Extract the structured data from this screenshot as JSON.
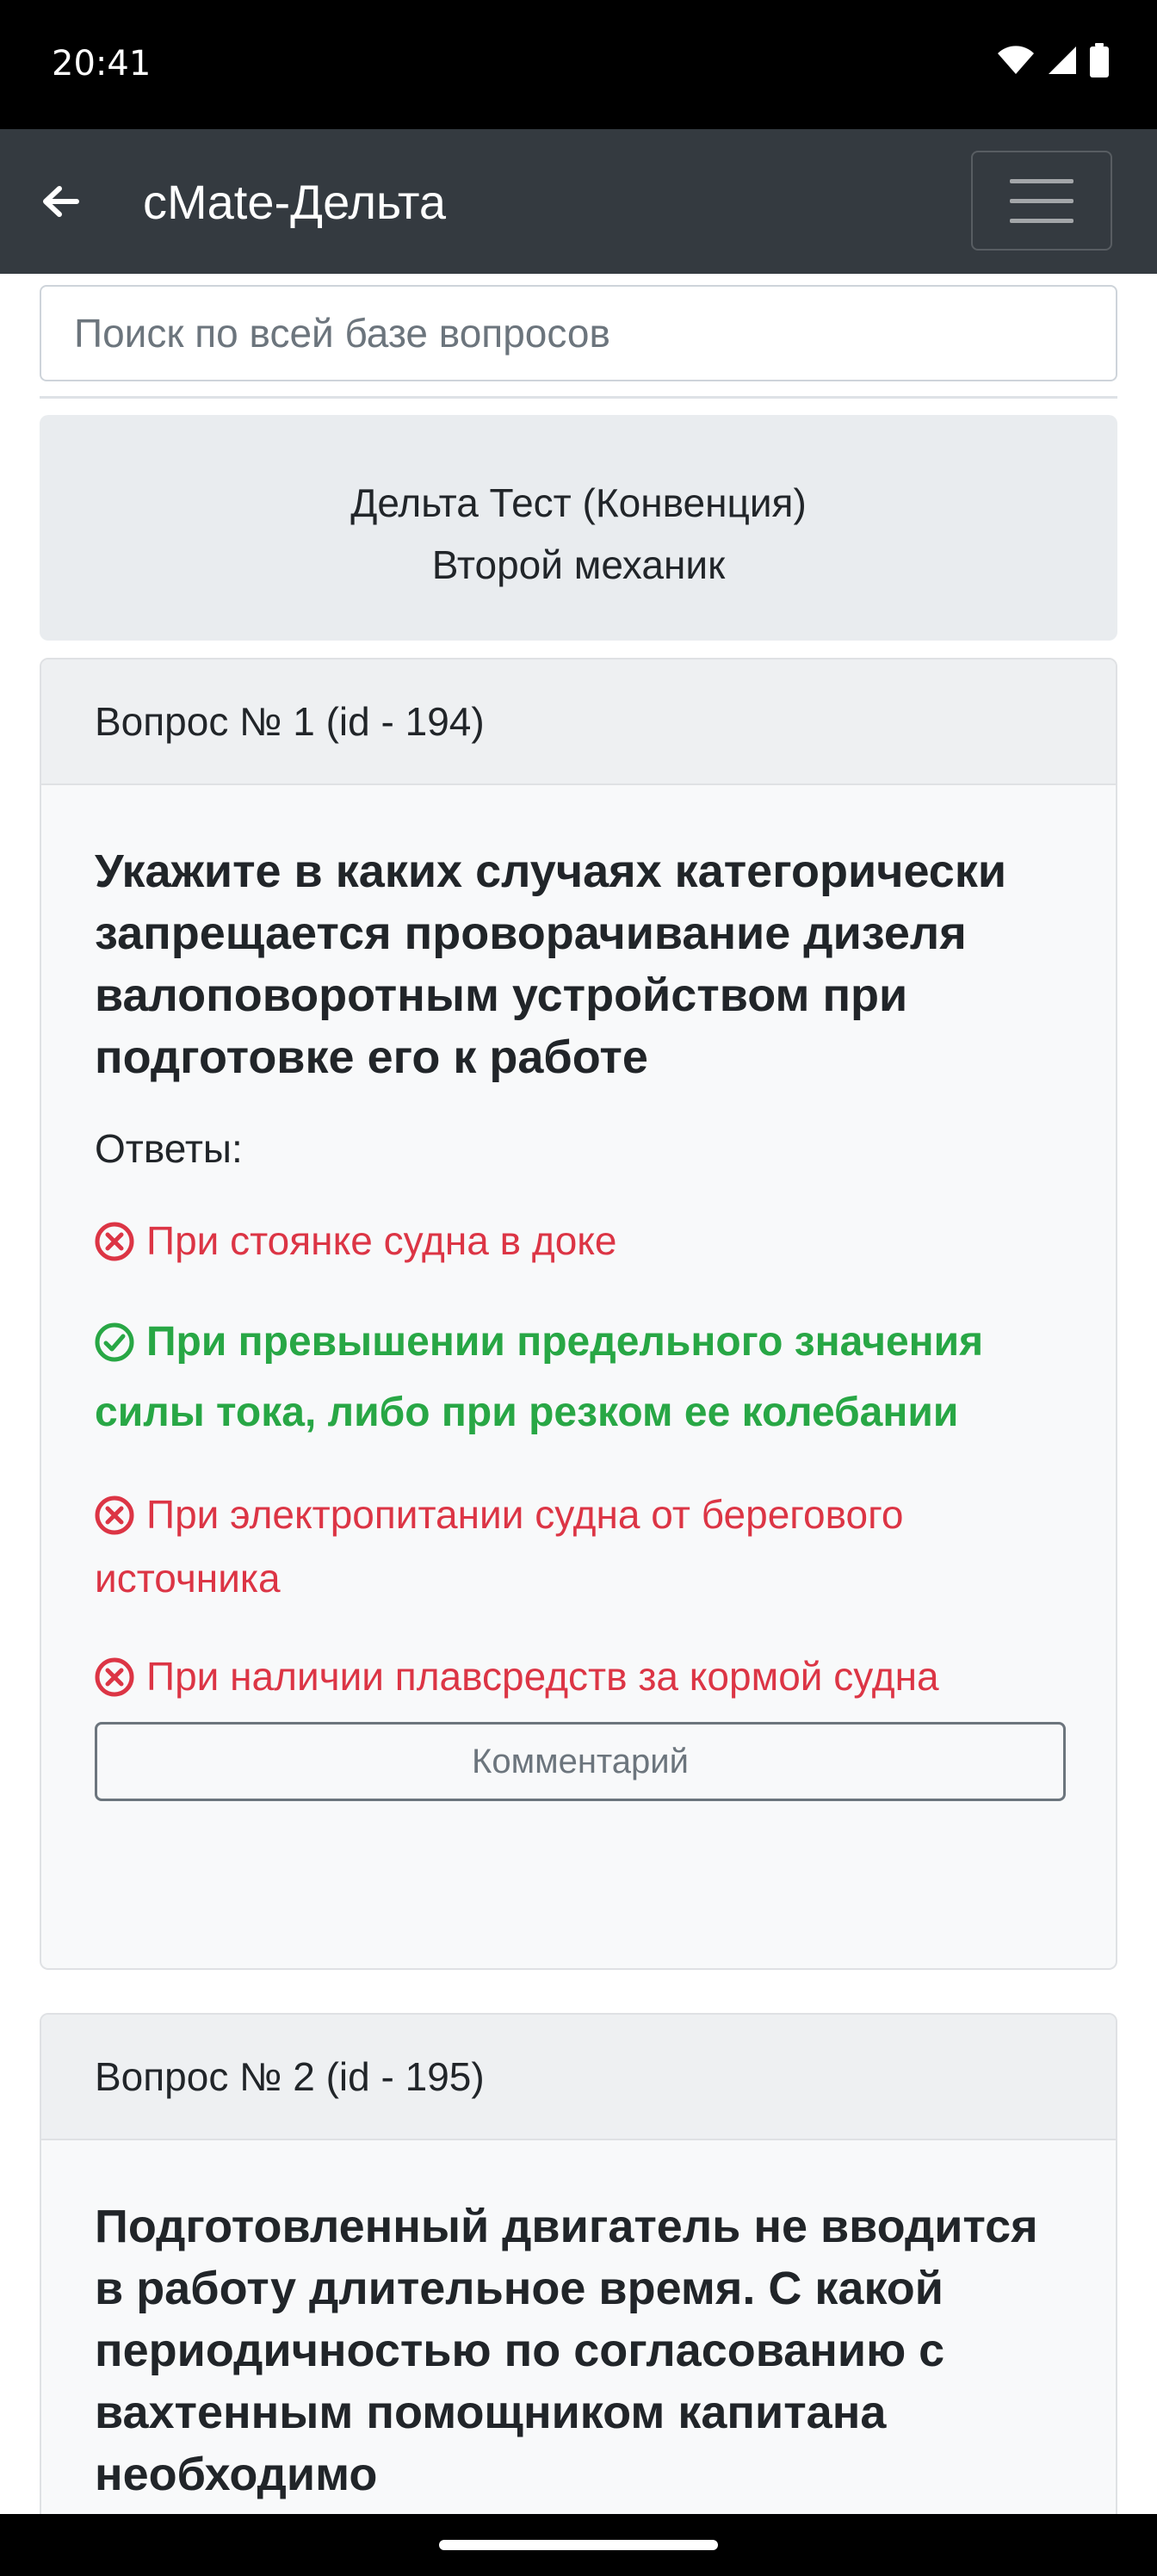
{
  "status_bar": {
    "time": "20:41",
    "icons": [
      "wifi-icon",
      "signal-icon",
      "battery-icon"
    ]
  },
  "navbar": {
    "title": "cMate-Дельта",
    "back_icon": "arrow-left-icon",
    "menu_icon": "hamburger-menu-icon"
  },
  "search": {
    "placeholder": "Поиск по всей базе вопросов",
    "value": ""
  },
  "test_info": {
    "title": "Дельта Тест (Конвенция)",
    "subtitle": "Второй механик"
  },
  "questions": [
    {
      "header": "Вопрос № 1 (id - 194)",
      "text": "Укажите в каких случаях категорически запрещается проворачивание дизеля валоповоротным устройством при подготовке его к работе",
      "answers_label": "Ответы:",
      "answers": [
        {
          "text": "При стоянке судна в доке",
          "status": "wrong",
          "icon": "x-circle-icon"
        },
        {
          "text": "При превышении предельного значения силы тока, либо при резком ее колебании",
          "status": "correct",
          "icon": "check-circle-icon"
        },
        {
          "text": "При электропитании судна от берегового источника",
          "status": "wrong",
          "icon": "x-circle-icon"
        },
        {
          "text": "При наличии плавсредств за кормой судна",
          "status": "wrong",
          "icon": "x-circle-icon"
        }
      ],
      "comment_label": "Комментарий"
    },
    {
      "header": "Вопрос № 2 (id - 195)",
      "text": "Подготовленный двигатель не вводится в работу длительное время. С какой периодичностью по согласованию с вахтенным помощником капитана необходимо"
    }
  ],
  "colors": {
    "navbar": "#343a40",
    "wrong": "#dc3545",
    "correct": "#28a745",
    "card_header": "#eef0f2",
    "test_box": "#e9ecef"
  }
}
